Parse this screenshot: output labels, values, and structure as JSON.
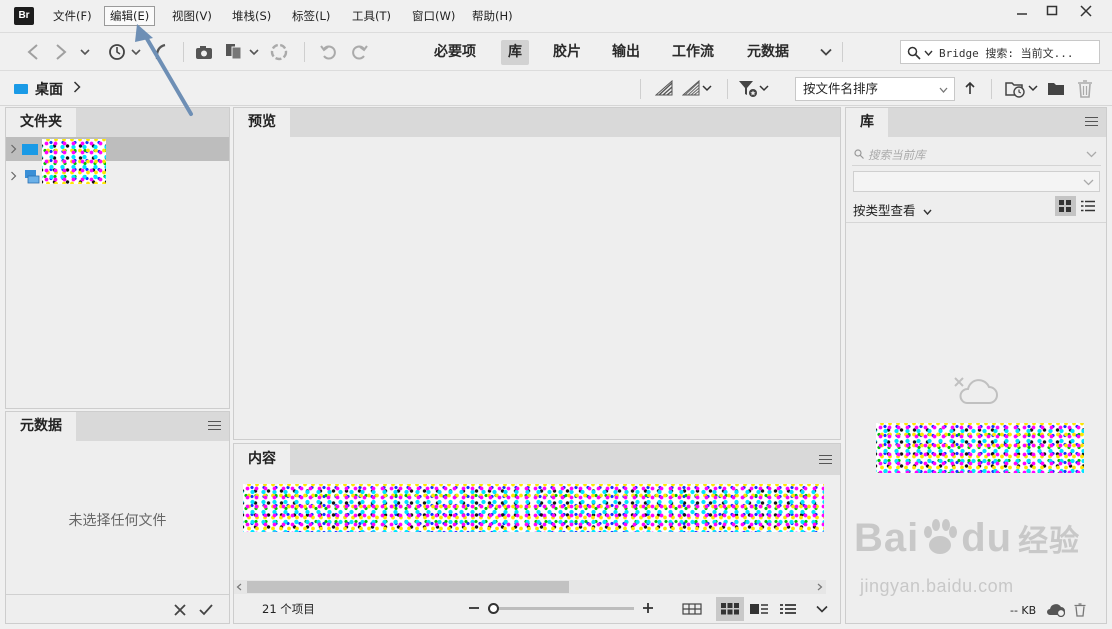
{
  "app": {
    "logo_text": "Br"
  },
  "menu": {
    "items": [
      {
        "label": "文件(F)"
      },
      {
        "label": "编辑(E)"
      },
      {
        "label": "视图(V)"
      },
      {
        "label": "堆栈(S)"
      },
      {
        "label": "标签(L)"
      },
      {
        "label": "工具(T)"
      },
      {
        "label": "窗口(W)"
      },
      {
        "label": "帮助(H)"
      }
    ],
    "active_index": 1
  },
  "workspaces": {
    "tabs": [
      {
        "label": "必要项"
      },
      {
        "label": "库"
      },
      {
        "label": "胶片"
      },
      {
        "label": "输出"
      },
      {
        "label": "工作流"
      },
      {
        "label": "元数据"
      }
    ],
    "active_index": 1
  },
  "search": {
    "placeholder": "Bridge 搜索: 当前文..."
  },
  "path": {
    "location": "桌面"
  },
  "sort": {
    "selected": "按文件名排序"
  },
  "panels": {
    "folders": {
      "tab": "文件夹"
    },
    "preview": {
      "tab": "预览"
    },
    "content": {
      "tab": "内容",
      "item_count": "21 个项目"
    },
    "metadata": {
      "tab": "元数据",
      "empty_text": "未选择任何文件"
    },
    "library": {
      "tab": "库",
      "search_placeholder": "搜索当前库",
      "view_by": "按类型查看",
      "size_text": "-- KB"
    }
  },
  "watermark": {
    "brand_latin": "Bai",
    "brand_latin2": "du",
    "brand_cn": "经验",
    "url": "jingyan.baidu.com"
  },
  "colors": {
    "arrow": "#6e8fb5",
    "accent_folder": "#1a9ae6"
  }
}
